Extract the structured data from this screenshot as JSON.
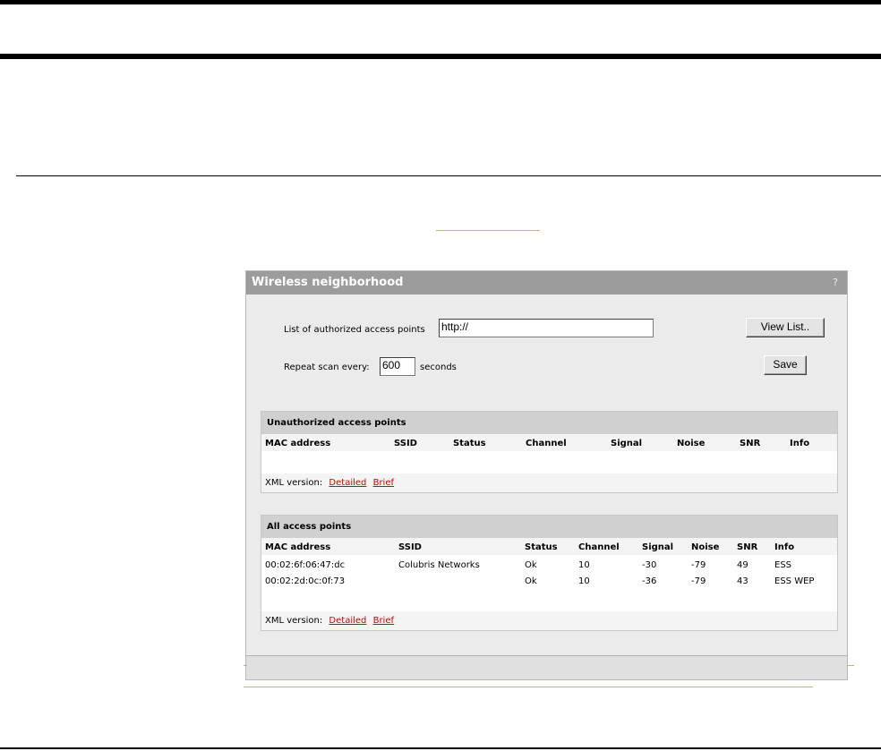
{
  "window": {
    "title": "Wireless neighborhood",
    "help": "?"
  },
  "form": {
    "auth_label": "List of authorized access points",
    "auth_value": "http://",
    "view_list_button": "View List..",
    "repeat_label": "Repeat scan every:",
    "repeat_value": "600",
    "repeat_unit": "seconds",
    "save_button": "Save"
  },
  "unauthorized": {
    "title": "Unauthorized access points",
    "columns": [
      "MAC address",
      "SSID",
      "Status",
      "Channel",
      "Signal",
      "Noise",
      "SNR",
      "Info"
    ],
    "xml_label": "XML version:",
    "detailed": "Detailed",
    "brief": "Brief"
  },
  "all": {
    "title": "All access points",
    "columns": [
      "MAC address",
      "SSID",
      "Status",
      "Channel",
      "Signal",
      "Noise",
      "SNR",
      "Info"
    ],
    "rows": [
      [
        "00:02:6f:06:47:dc",
        "Colubris Networks",
        "Ok",
        "10",
        "-30",
        "-79",
        "49",
        "ESS"
      ],
      [
        "00:02:2d:0c:0f:73",
        "",
        "Ok",
        "10",
        "-36",
        "-79",
        "43",
        "ESS WEP"
      ]
    ],
    "xml_label": "XML version:",
    "detailed": "Detailed",
    "brief": "Brief"
  }
}
